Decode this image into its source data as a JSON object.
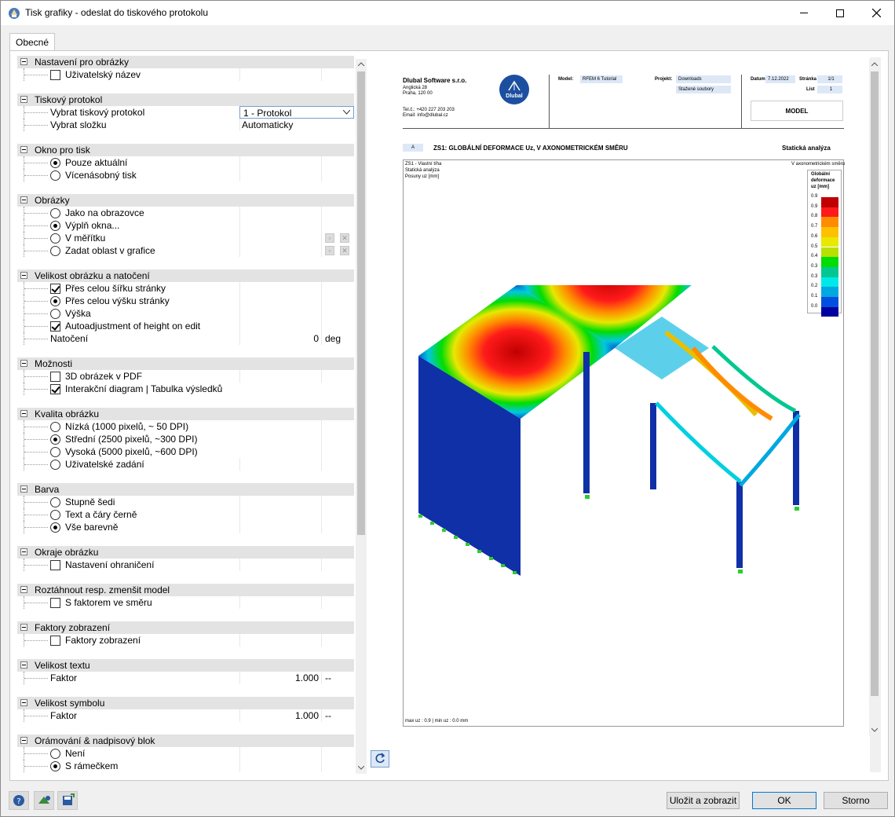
{
  "window": {
    "title": "Tisk grafiky - odeslat do tiskového protokolu"
  },
  "tab": {
    "label": "Obecné"
  },
  "sections": {
    "s1": {
      "title": "Nastavení pro obrázky",
      "r1": "Uživatelský název"
    },
    "s2": {
      "title": "Tiskový protokol",
      "r1": "Vybrat tiskový protokol",
      "r1_value": "1 - Protokol",
      "r2": "Vybrat složku",
      "r2_value": "Automaticky"
    },
    "s3": {
      "title": "Okno pro tisk",
      "r1": "Pouze aktuální",
      "r2": "Vícenásobný tisk"
    },
    "s4": {
      "title": "Obrázky",
      "r1": "Jako na obrazovce",
      "r2": "Výplň okna...",
      "r3": "V měřítku",
      "r4": "Zadat oblast v grafice"
    },
    "s5": {
      "title": "Velikost obrázku a natočení",
      "r1": "Přes celou šířku stránky",
      "r2": "Přes celou výšku stránky",
      "r3": "Výška",
      "r4": "Autoadjustment of height on edit",
      "r5": "Natočení",
      "r5_value": "0",
      "r5_unit": "deg"
    },
    "s6": {
      "title": "Možnosti",
      "r1": "3D obrázek v PDF",
      "r2": "Interakční diagram | Tabulka výsledků"
    },
    "s7": {
      "title": "Kvalita obrázku",
      "r1": "Nízká (1000 pixelů, ~ 50 DPI)",
      "r2": "Střední (2500 pixelů, ~300 DPI)",
      "r3": "Vysoká (5000 pixelů, ~600 DPI)",
      "r4": "Uživatelské zadání"
    },
    "s8": {
      "title": "Barva",
      "r1": "Stupně šedi",
      "r2": "Text a čáry černě",
      "r3": "Vše barevně"
    },
    "s9": {
      "title": "Okraje obrázku",
      "r1": "Nastavení ohraničení"
    },
    "s10": {
      "title": "Roztáhnout resp. zmenšit model",
      "r1": "S faktorem ve směru"
    },
    "s11": {
      "title": "Faktory zobrazení",
      "r1": "Faktory zobrazení"
    },
    "s12": {
      "title": "Velikost textu",
      "r1": "Faktor",
      "r1_value": "1.000",
      "r1_unit": "--"
    },
    "s13": {
      "title": "Velikost symbolu",
      "r1": "Faktor",
      "r1_value": "1.000",
      "r1_unit": "--"
    },
    "s14": {
      "title": "Orámování & nadpisový blok",
      "r1": "Není",
      "r2": "S rámečkem"
    }
  },
  "preview": {
    "company": "Dlubal Software s.r.o.",
    "addr1": "Anglická 28",
    "addr2": "Praha, 120 00",
    "tel": "Tel.č.: +420 227 203 203",
    "email": "Email: info@dlubal.cz",
    "logo_text": "Dlubal",
    "model_label": "Model:",
    "model_value": "RFEM 6 Tutorial",
    "project_label": "Projekt:",
    "project_value": "Downloads",
    "project_value2": "Stažené soubory",
    "date_label": "Datum",
    "date_value": "7.12.2022",
    "page_label": "Stránka",
    "page_value": "1/1",
    "sheet_label": "List",
    "sheet_value": "1",
    "model_box": "MODEL",
    "section_letter": "A",
    "heading": "ZS1: GLOBÁLNÍ DEFORMACE Uz, V AXONOMETRICKÉM SMĚRU",
    "heading_right": "Statická analýza",
    "info1": "ZS1 - Vlastní tíha",
    "info2": "Statická analýza",
    "info3": "Posuny uz [mm]",
    "view_dir": "V axonometrickém směru",
    "legend_title1": "Globální",
    "legend_title2": "deformace",
    "legend_title3": "uz [mm]",
    "legend_values": [
      "0.9",
      "0.9",
      "0.8",
      "0.7",
      "0.6",
      "0.5",
      "0.4",
      "0.3",
      "0.3",
      "0.2",
      "0.1",
      "0.0"
    ],
    "legend_colors": [
      "#c00000",
      "#ff1a1a",
      "#ff8c00",
      "#ffc000",
      "#e8e800",
      "#b8e000",
      "#00dd00",
      "#00c890",
      "#00e8e8",
      "#00a8e0",
      "#0050e0",
      "#0000a0"
    ],
    "footer_note": "max uz : 0.9 | min uz : 0.0 mm"
  },
  "buttons": {
    "save_show": "Uložit a zobrazit",
    "ok": "OK",
    "cancel": "Storno"
  }
}
